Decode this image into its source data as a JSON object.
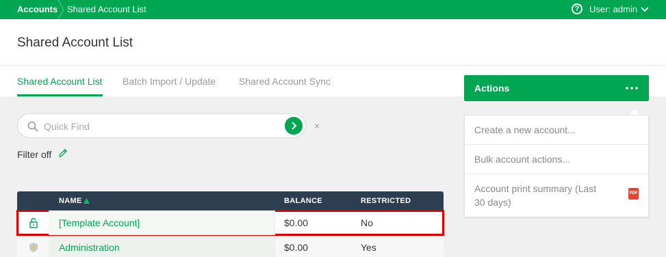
{
  "topbar": {
    "breadcrumb_root": "Accounts",
    "breadcrumb_current": "Shared Account List",
    "help_icon": "?",
    "user_label": "User: admin",
    "brand_color": "#00a651"
  },
  "header": {
    "title": "Shared Account List"
  },
  "tabs": [
    {
      "label": "Shared Account List",
      "active": true
    },
    {
      "label": "Batch Import / Update",
      "active": false
    },
    {
      "label": "Shared Account Sync",
      "active": false
    }
  ],
  "search": {
    "placeholder": "Quick Find",
    "value": "",
    "clear_glyph": "×"
  },
  "filter": {
    "label": "Filter off"
  },
  "table": {
    "header_color": "#2d3e50",
    "columns": [
      "NAME",
      "BALANCE",
      "RESTRICTED"
    ],
    "sort": {
      "column": "NAME",
      "direction": "ascending"
    },
    "rows": [
      {
        "icon": "unlocked-padlock-icon",
        "name": "[Template Account]",
        "balance": "$0.00",
        "restricted": "No",
        "highlighted": true
      },
      {
        "icon": "shield-badge-icon",
        "name": "Administration",
        "balance": "$0.00",
        "restricted": "Yes",
        "highlighted": false
      }
    ]
  },
  "actions": {
    "label": "Actions",
    "menu": [
      {
        "label": "Create a new account..."
      },
      {
        "label": "Bulk account actions..."
      },
      {
        "label": "Account print summary (Last 30 days)",
        "badge": "PDF"
      }
    ]
  }
}
